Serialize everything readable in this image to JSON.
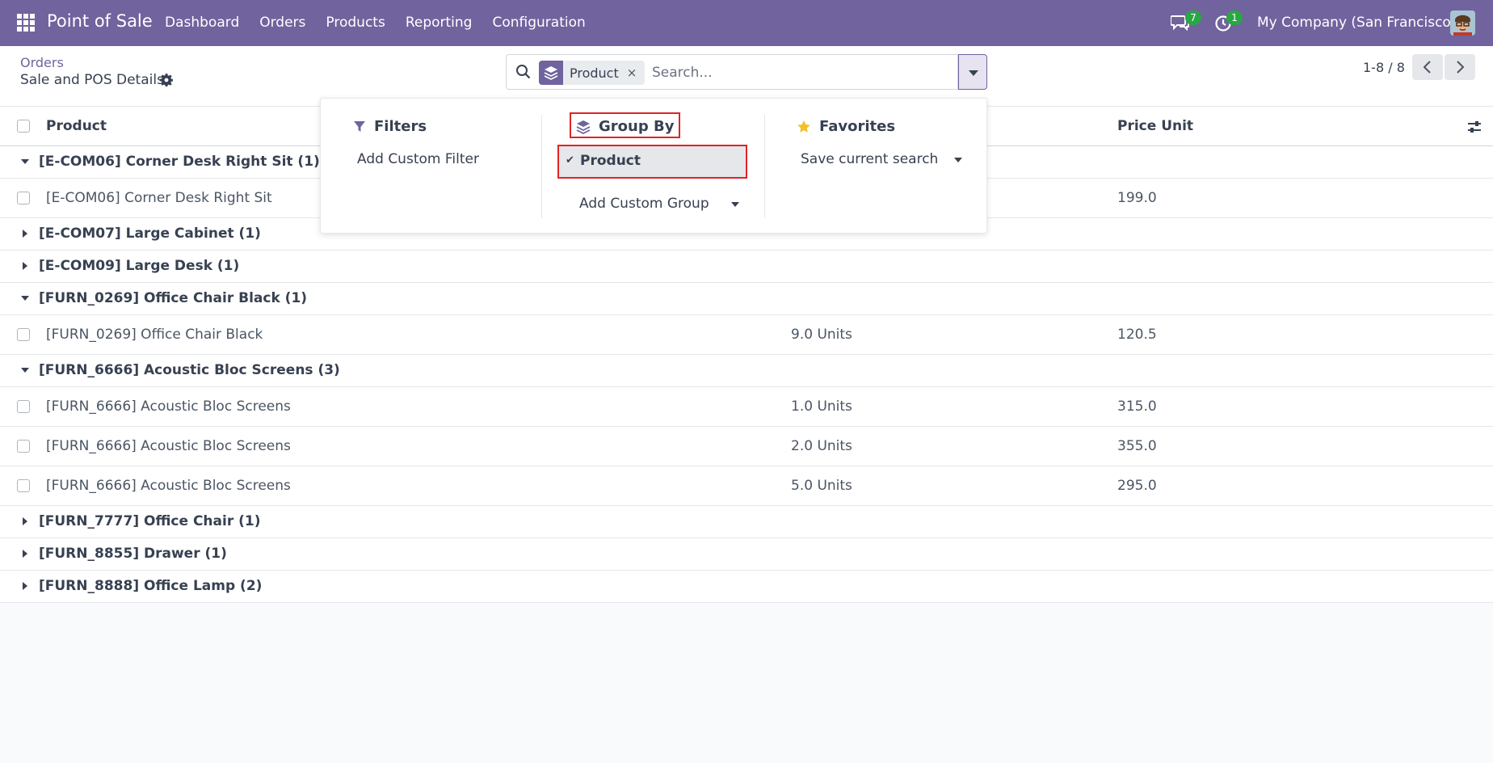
{
  "navbar": {
    "app_title": "Point of Sale",
    "menu": [
      "Dashboard",
      "Orders",
      "Products",
      "Reporting",
      "Configuration"
    ],
    "messages_count": "7",
    "activities_count": "1",
    "company": "My Company (San Francisco)"
  },
  "control_panel": {
    "breadcrumb": "Orders",
    "title": "Sale and POS Details",
    "search": {
      "facet": "Product",
      "facet_remove": "×",
      "placeholder": "Search..."
    },
    "pager": "1-8 / 8"
  },
  "dropdown": {
    "filters": {
      "heading": "Filters",
      "add_custom_filter": "Add Custom Filter"
    },
    "group_by": {
      "heading": "Group By",
      "selected_option": "Product",
      "check": "✔",
      "add_custom_group": "Add Custom Group"
    },
    "favorites": {
      "heading": "Favorites",
      "save_current_search": "Save current search"
    }
  },
  "list": {
    "columns": {
      "product": "Product",
      "price_unit": "Price Unit"
    },
    "rows": [
      {
        "type": "group",
        "label": "[E-COM06] Corner Desk Right Sit (1)",
        "expanded": true
      },
      {
        "type": "record",
        "product": "[E-COM06] Corner Desk Right Sit",
        "qty": "",
        "price": "199.0"
      },
      {
        "type": "group",
        "label": "[E-COM07] Large Cabinet (1)",
        "expanded": false
      },
      {
        "type": "group",
        "label": "[E-COM09] Large Desk (1)",
        "expanded": false
      },
      {
        "type": "group",
        "label": "[FURN_0269] Office Chair Black (1)",
        "expanded": true
      },
      {
        "type": "record",
        "product": "[FURN_0269] Office Chair Black",
        "qty": "9.0 Units",
        "price": "120.5"
      },
      {
        "type": "group",
        "label": "[FURN_6666] Acoustic Bloc Screens (3)",
        "expanded": true
      },
      {
        "type": "record",
        "product": "[FURN_6666] Acoustic Bloc Screens",
        "qty": "1.0 Units",
        "price": "315.0"
      },
      {
        "type": "record",
        "product": "[FURN_6666] Acoustic Bloc Screens",
        "qty": "2.0 Units",
        "price": "355.0"
      },
      {
        "type": "record",
        "product": "[FURN_6666] Acoustic Bloc Screens",
        "qty": "5.0 Units",
        "price": "295.0"
      },
      {
        "type": "group",
        "label": "[FURN_7777] Office Chair (1)",
        "expanded": false
      },
      {
        "type": "group",
        "label": "[FURN_8855] Drawer (1)",
        "expanded": false
      },
      {
        "type": "group",
        "label": "[FURN_8888] Office Lamp (2)",
        "expanded": false
      }
    ]
  },
  "colors": {
    "brand": "#71639e",
    "badge": "#28a745",
    "highlight": "#e02424"
  }
}
